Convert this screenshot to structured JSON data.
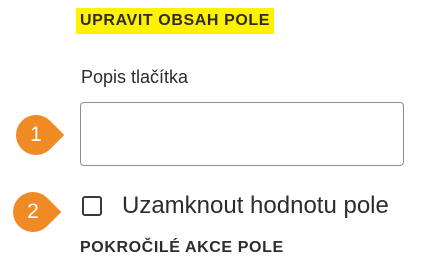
{
  "section": {
    "heading": "UPRAVIT OBSAH POLE",
    "highlight_color": "#fff200"
  },
  "field": {
    "label": "Popis tlačítka",
    "value": "",
    "placeholder": ""
  },
  "lock_option": {
    "label": "Uzamknout hodnotu pole",
    "checked": false
  },
  "advanced": {
    "heading": "POKROČILÉ AKCE POLE"
  },
  "callouts": [
    {
      "number": "1",
      "color": "#f08a24"
    },
    {
      "number": "2",
      "color": "#f08a24"
    }
  ]
}
